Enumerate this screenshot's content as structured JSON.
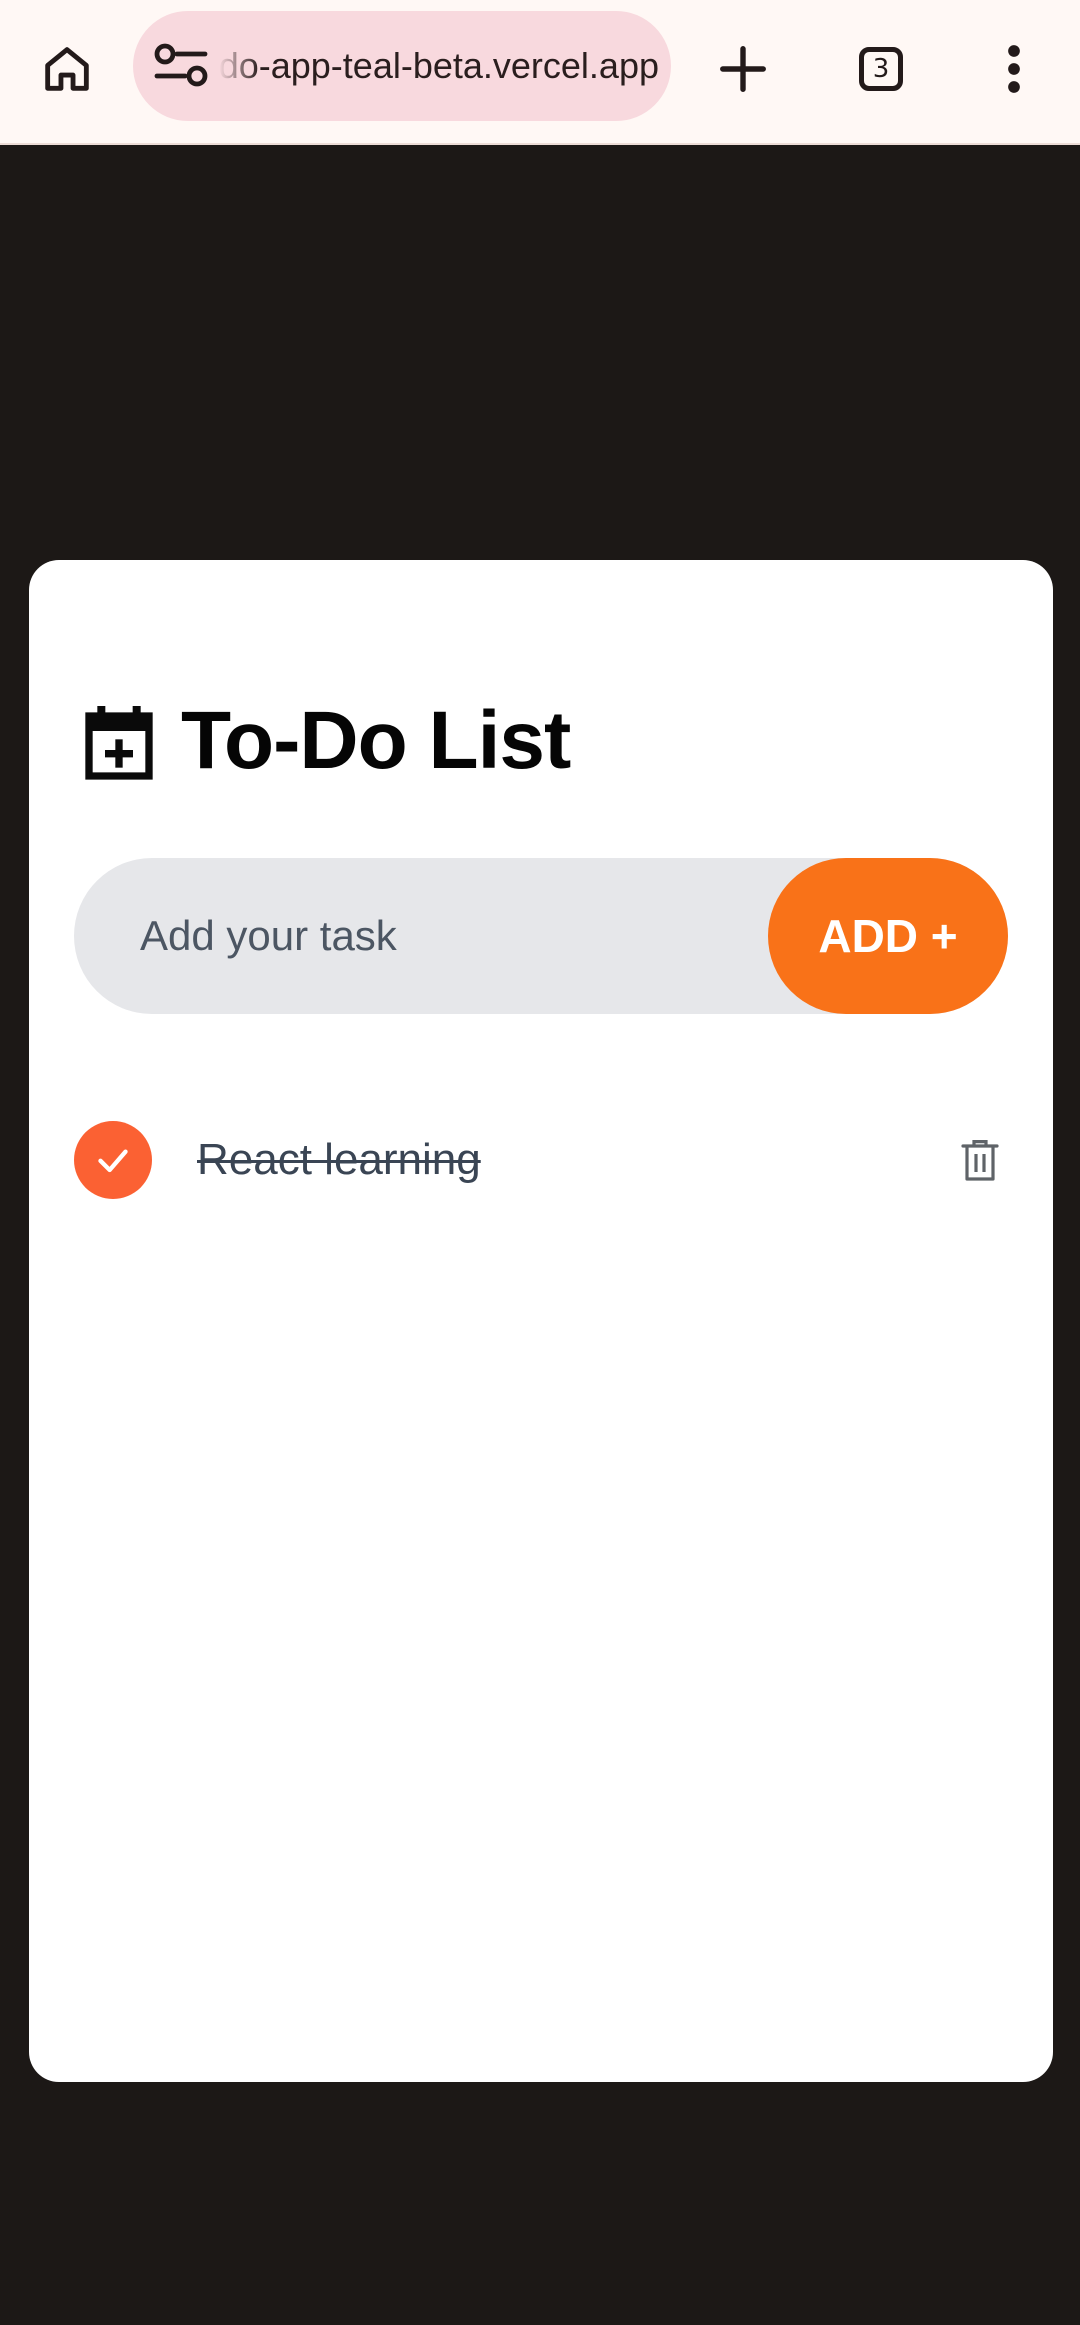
{
  "browser": {
    "url": "todo-app-teal-beta.vercel.app",
    "tab_count": "3",
    "icons": {
      "home": "home-icon",
      "site_settings": "tune-icon",
      "new_tab": "plus-icon",
      "tabs": "tab-switcher-icon",
      "menu": "more-vert-icon"
    }
  },
  "app": {
    "title": "To-Do List",
    "title_icon": "calendar-add-icon",
    "input": {
      "placeholder": "Add your task",
      "value": ""
    },
    "add_button_label": "ADD +",
    "tasks": [
      {
        "text": "React learning",
        "completed": true
      }
    ]
  },
  "colors": {
    "accent": "#f97218",
    "check": "#fb6133",
    "background": "#1c1816",
    "url_pill": "#f8d9de"
  }
}
